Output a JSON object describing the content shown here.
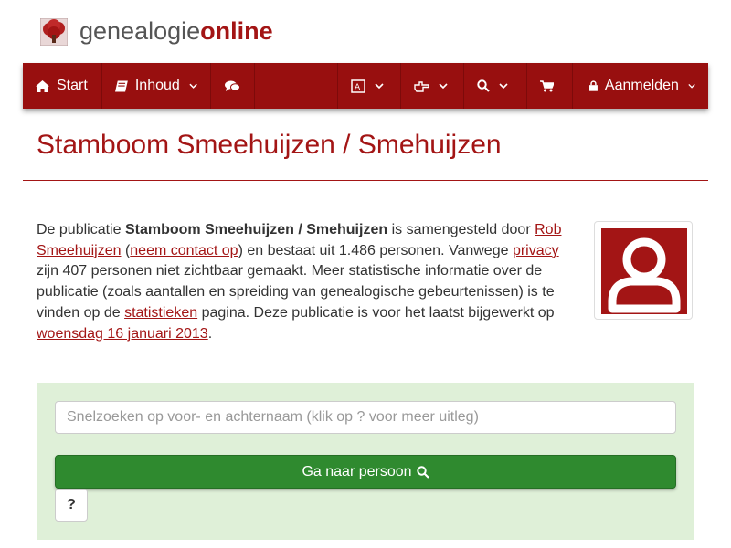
{
  "site": {
    "logo_prefix": "genealogie",
    "logo_suffix": "online"
  },
  "nav": {
    "start": "Start",
    "contents": "Inhoud",
    "login": "Aanmelden"
  },
  "page": {
    "title": "Stamboom Smeehuijzen / Smehuijzen"
  },
  "intro": {
    "t1": "De publicatie ",
    "publication": "Stamboom Smeehuijzen / Smehuijzen",
    "t2": " is samengesteld door ",
    "author": "Rob Smeehuijzen",
    "t3": " (",
    "contact": "neem contact op",
    "t4": ") en bestaat uit 1.486 personen. Vanwege ",
    "privacy": "privacy",
    "t5": " zijn 407 personen niet zichtbaar gemaakt. Meer statistische informatie over de publicatie (zoals aantallen en spreiding van genealogische gebeurtenissen) is te vinden op de ",
    "stats": "statistieken",
    "t6": " pagina. Deze publicatie is voor het laatst bijgewerkt op ",
    "date": "woensdag 16 januari 2013",
    "t7": "."
  },
  "search": {
    "placeholder": "Snelzoeken op voor- en achternaam (klik op ? voor meer uitleg)",
    "button": "Ga naar persoon",
    "help": "?"
  },
  "colors": {
    "brand": "#980f0f",
    "accent": "#a31515",
    "panel": "#dff0d8",
    "button": "#2f8a2f"
  }
}
